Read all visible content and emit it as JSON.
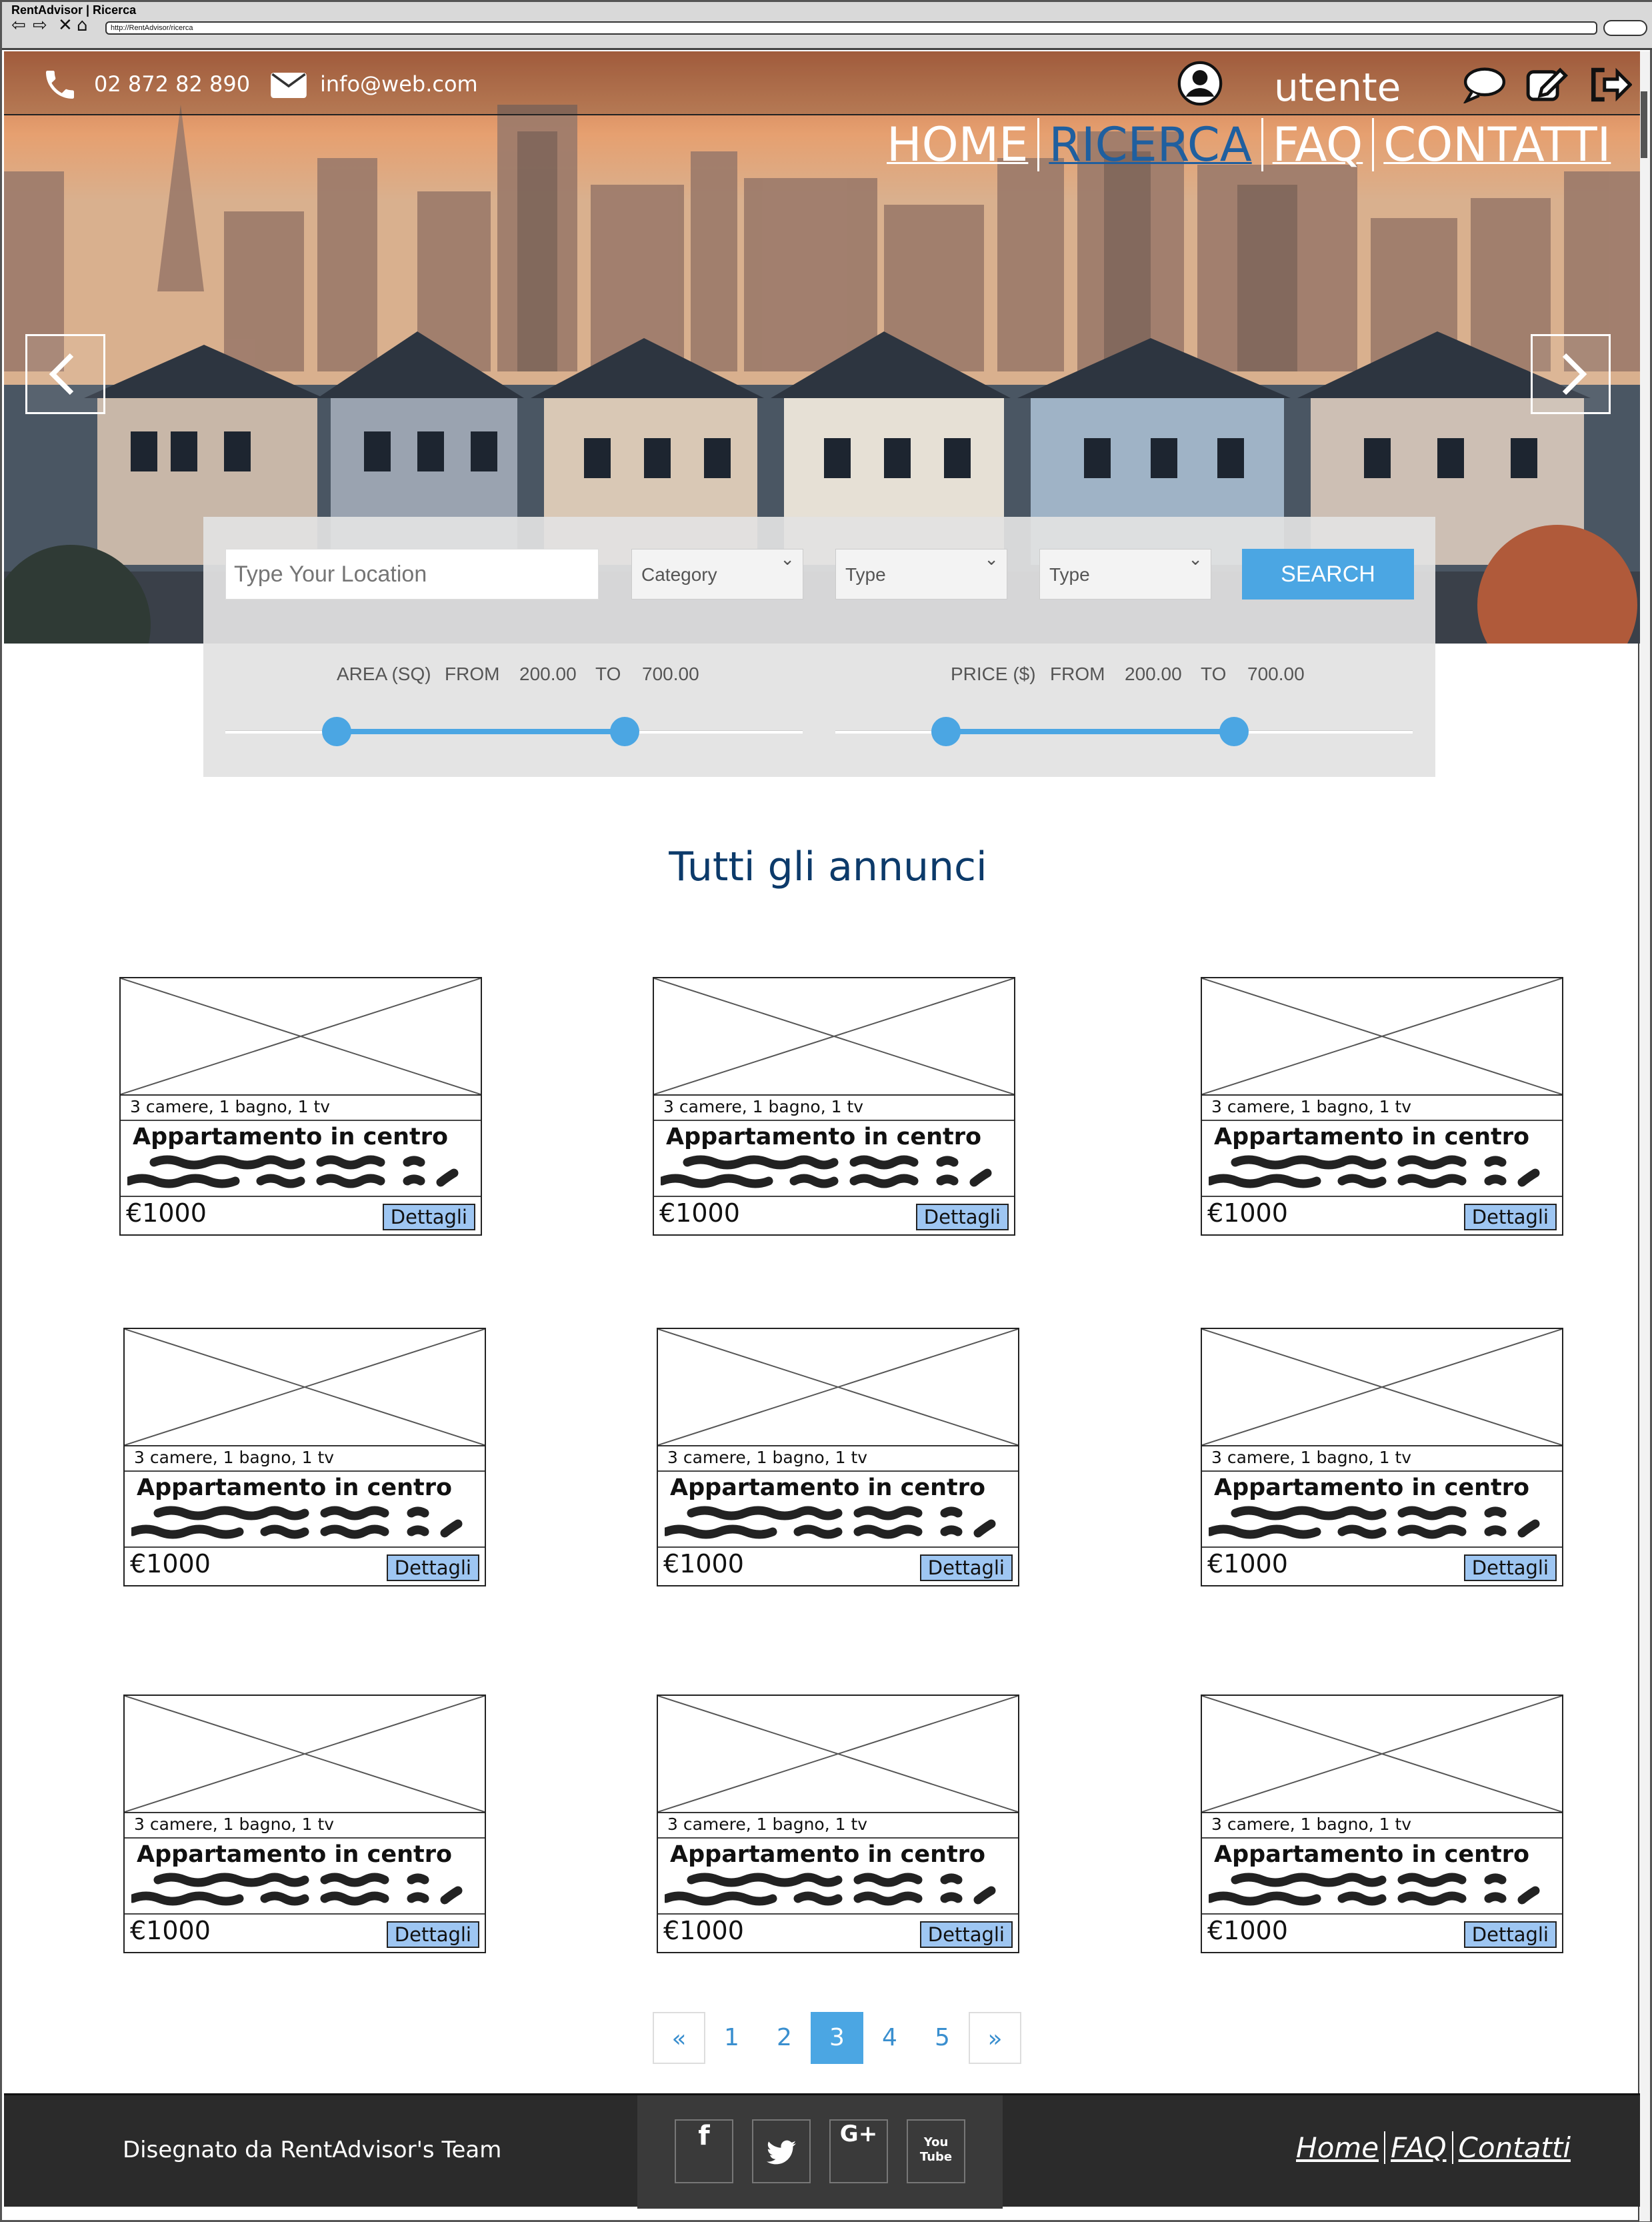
{
  "window": {
    "title": "RentAdvisor | Ricerca",
    "url": "http://RentAdvisor/ricerca"
  },
  "topbar": {
    "phone": "02 872 82 890",
    "email": "info@web.com",
    "user": "utente"
  },
  "nav": {
    "home": "HOME",
    "ricerca": "RICERCA",
    "faq": "FAQ",
    "contatti": "CONTATTI",
    "active": "RICERCA"
  },
  "search": {
    "location_placeholder": "Type Your Location",
    "category": "Category",
    "type1": "Type",
    "type2": "Type",
    "button": "SEARCH",
    "area": {
      "label": "AREA (SQ)",
      "from_label": "FROM",
      "from": "200.00",
      "to_label": "TO",
      "to": "700.00"
    },
    "price": {
      "label": "PRICE ($)",
      "from_label": "FROM",
      "from": "200.00",
      "to_label": "TO",
      "to": "700.00"
    }
  },
  "section_title": "Tutti gli annunci",
  "listings": [
    {
      "features": "3 camere, 1 bagno, 1 tv",
      "title": "Appartamento in centro",
      "price": "€1000",
      "button": "Dettagli"
    },
    {
      "features": "3 camere, 1 bagno, 1 tv",
      "title": "Appartamento in centro",
      "price": "€1000",
      "button": "Dettagli"
    },
    {
      "features": "3 camere, 1 bagno, 1 tv",
      "title": "Appartamento in centro",
      "price": "€1000",
      "button": "Dettagli"
    },
    {
      "features": "3 camere, 1 bagno, 1 tv",
      "title": "Appartamento in centro",
      "price": "€1000",
      "button": "Dettagli"
    },
    {
      "features": "3 camere, 1 bagno, 1 tv",
      "title": "Appartamento in centro",
      "price": "€1000",
      "button": "Dettagli"
    },
    {
      "features": "3 camere, 1 bagno, 1 tv",
      "title": "Appartamento in centro",
      "price": "€1000",
      "button": "Dettagli"
    },
    {
      "features": "3 camere, 1 bagno, 1 tv",
      "title": "Appartamento in centro",
      "price": "€1000",
      "button": "Dettagli"
    },
    {
      "features": "3 camere, 1 bagno, 1 tv",
      "title": "Appartamento in centro",
      "price": "€1000",
      "button": "Dettagli"
    },
    {
      "features": "3 camere, 1 bagno, 1 tv",
      "title": "Appartamento in centro",
      "price": "€1000",
      "button": "Dettagli"
    }
  ],
  "pagination": {
    "prev": "«",
    "pages": [
      "1",
      "2",
      "3",
      "4",
      "5"
    ],
    "current": "3",
    "next": "»"
  },
  "footer": {
    "credit": "Disegnato da RentAdvisor's Team",
    "social": [
      "f",
      "twitter",
      "G+",
      "You Tube"
    ],
    "links": {
      "home": "Home",
      "faq": "FAQ",
      "contatti": "Contatti"
    }
  },
  "colors": {
    "accent": "#4ba6e3",
    "nav_active": "#1f5f9f",
    "title": "#0c3a6a",
    "button": "#9ec6f2",
    "footer": "#2b2b2b"
  }
}
